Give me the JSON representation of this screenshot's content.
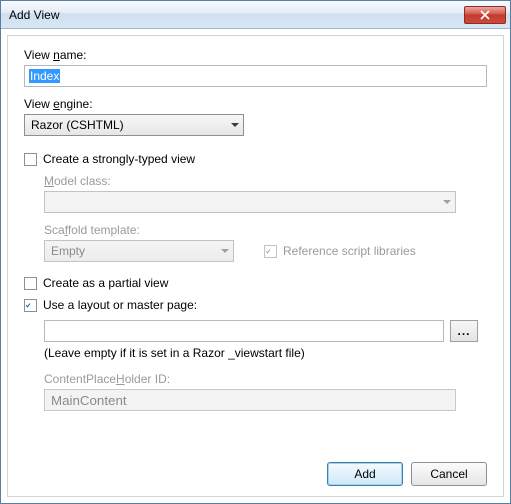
{
  "window": {
    "title": "Add View"
  },
  "fields": {
    "view_name_label": "View name:",
    "view_name_value": "Index",
    "view_engine_label": "View engine:",
    "view_engine_value": "Razor (CSHTML)"
  },
  "strongly_typed": {
    "checkbox_label": "Create a strongly-typed view",
    "checked": false,
    "model_class_label": "Model class:",
    "model_class_value": "",
    "scaffold_label": "Scaffold template:",
    "scaffold_value": "Empty",
    "ref_scripts_label": "Reference script libraries",
    "ref_scripts_checked": true
  },
  "partial_view": {
    "label": "Create as a partial view",
    "checked": false
  },
  "layout": {
    "label": "Use a layout or master page:",
    "checked": true,
    "path_value": "",
    "browse_label": "...",
    "hint": "(Leave empty if it is set in a Razor _viewstart file)",
    "cph_label": "ContentPlaceHolder ID:",
    "cph_value": "MainContent"
  },
  "buttons": {
    "add": "Add",
    "cancel": "Cancel"
  }
}
